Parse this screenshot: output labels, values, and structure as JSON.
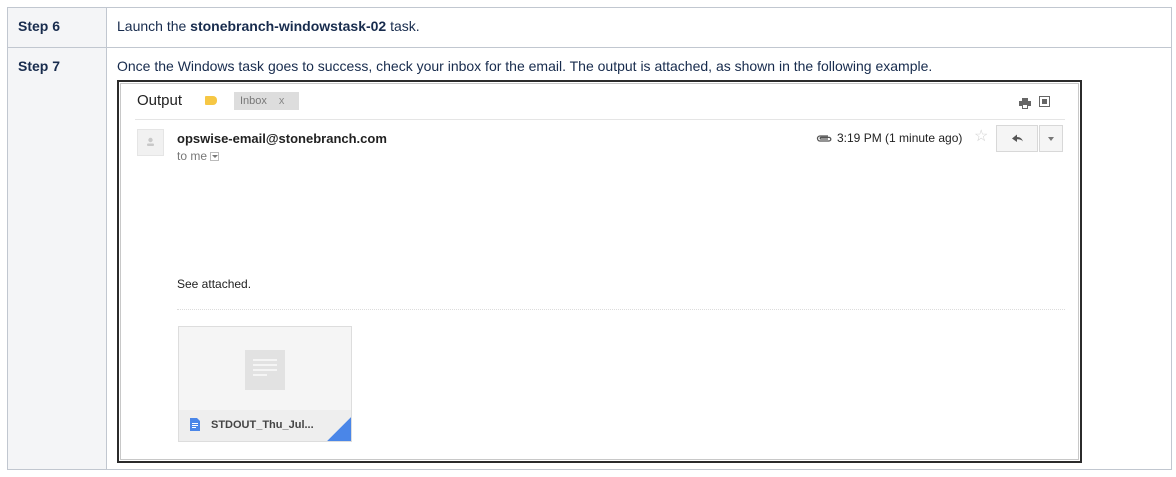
{
  "steps": [
    {
      "label": "Step 6",
      "text_before": "Launch the ",
      "text_bold": "stonebranch-windowstask-02",
      "text_after": " task."
    },
    {
      "label": "Step 7",
      "text": "Once the Windows task goes to success, check your inbox for the email. The output is attached, as shown in the following example."
    }
  ],
  "email": {
    "subject": "Output",
    "label_chip": "Inbox",
    "label_chip_close": "x",
    "label_color": "#f6c744",
    "sender": "opswise-email@stonebranch.com",
    "recipient": "to me",
    "time": "3:19 PM (1 minute ago)",
    "body": "See attached.",
    "attachment": {
      "filename": "STDOUT_Thu_Jul...",
      "icon": "google-doc-icon",
      "accent_color": "#4a86e8"
    },
    "icons": [
      "print-icon",
      "new-window-icon",
      "paperclip-icon",
      "star-icon",
      "reply-icon",
      "more-options-icon"
    ]
  }
}
